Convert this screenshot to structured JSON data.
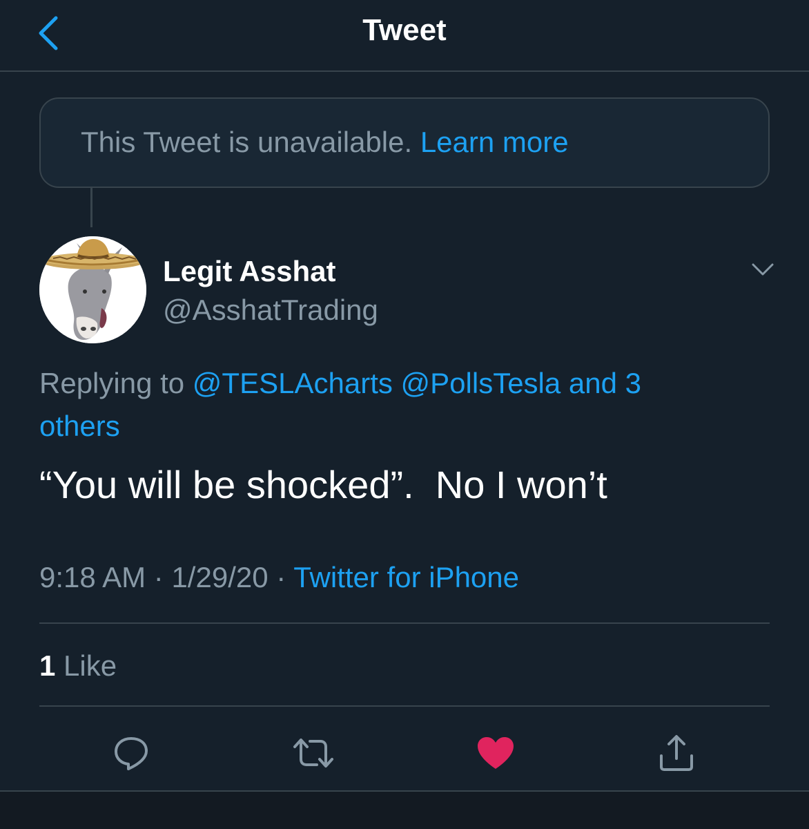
{
  "header": {
    "title": "Tweet",
    "back_icon": "chevron-left-icon"
  },
  "unavailable_notice": {
    "text": "This Tweet is unavailable.",
    "link": "Learn more"
  },
  "tweet": {
    "author": {
      "display_name": "Legit Asshat",
      "handle": "@AsshatTrading",
      "avatar": "donkey-with-sombrero"
    },
    "replying_to": {
      "prefix": "Replying to",
      "users": [
        "@TESLAcharts",
        "@PollsTesla"
      ],
      "others": "and 3 others"
    },
    "text": "“You will be shocked”.  No I won’t",
    "time": "9:18 AM",
    "date": "1/29/20",
    "source": "Twitter for iPhone",
    "likes": {
      "count": "1",
      "label": "Like"
    }
  },
  "actions": {
    "reply_icon": "reply-icon",
    "retweet_icon": "retweet-icon",
    "like_icon": "heart-icon",
    "share_icon": "share-icon",
    "liked": true
  },
  "colors": {
    "background": "#15202b",
    "accent": "#1da1f2",
    "muted": "#8899a6",
    "like": "#e0245e",
    "border": "#38444d"
  }
}
